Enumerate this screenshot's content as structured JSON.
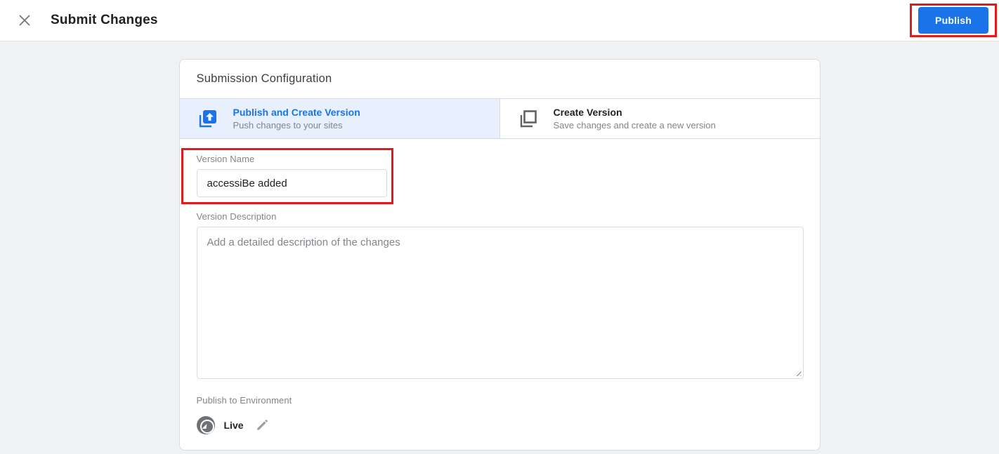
{
  "colors": {
    "page_bg": "#f0f1f2",
    "accent_blue": "#1a73e8",
    "annotation_red": "#e01b1b",
    "selected_tab_bg": "#e8f0fe",
    "text_dark": "#202124",
    "text_gray": "#80868b",
    "border_gray": "#dadce0",
    "icon_gray": "#5f6368"
  },
  "topbar": {
    "close_icon": "close-icon",
    "title": "Submit Changes",
    "publish_button_label": "Publish"
  },
  "card": {
    "title": "Submission Configuration",
    "tabs": [
      {
        "icon": "publish-upload-icon",
        "label": "Publish and Create Version",
        "description": "Push changes to your sites",
        "selected": true
      },
      {
        "icon": "stacked-pages-icon",
        "label": "Create Version",
        "description": "Save changes and create a new version",
        "selected": false
      }
    ],
    "form": {
      "version_name": {
        "label": "Version Name",
        "value": "accessiBe added"
      },
      "version_description": {
        "label": "Version Description",
        "placeholder": "Add a detailed description of the changes",
        "value": ""
      },
      "environment": {
        "label": "Publish to Environment",
        "value": "Live",
        "icons": [
          "live-environment-icon",
          "edit-pencil-icon"
        ]
      }
    }
  },
  "annotations": {
    "highlighted_elements": [
      "publish-button",
      "version-name-field"
    ]
  }
}
